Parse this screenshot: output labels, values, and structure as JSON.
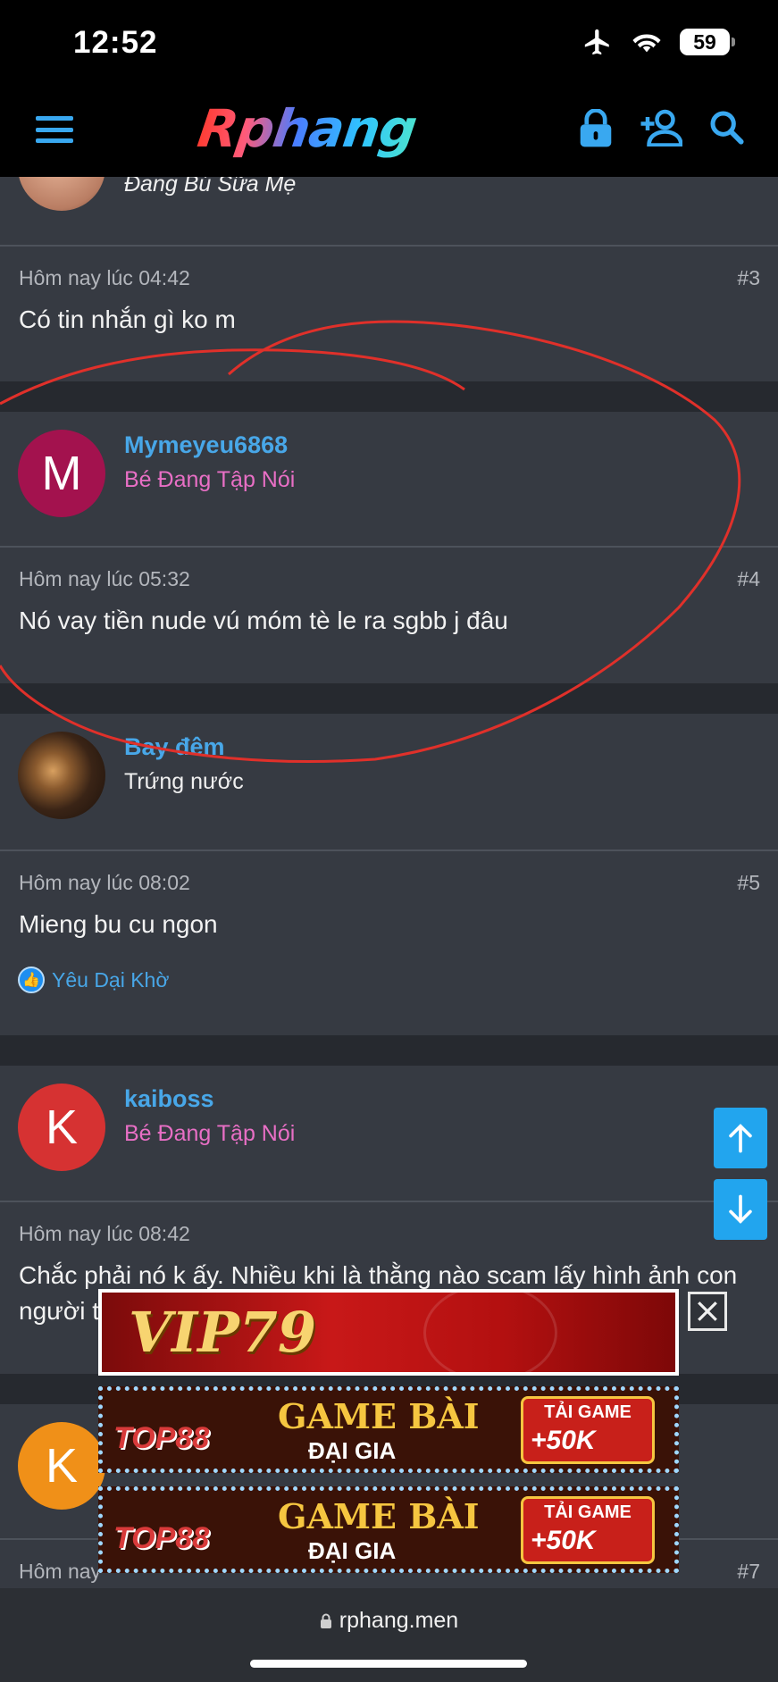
{
  "status_bar": {
    "time": "12:52",
    "battery": "59"
  },
  "nav": {
    "logo_text": "Rphang"
  },
  "posts": [
    {
      "user_title": "Đang Bú Sữa Mẹ"
    },
    {
      "timestamp": "Hôm nay lúc 04:42",
      "number": "#3",
      "message": "Có tin nhắn gì ko m"
    },
    {
      "avatar_letter": "M",
      "avatar_color": "#a3124e",
      "username": "Mymeyeu6868",
      "user_title": "Bé Đang Tập Nói",
      "user_title_color": "#e86fc5",
      "timestamp": "Hôm nay lúc 05:32",
      "number": "#4",
      "message": "Nó vay tiền nude vú móm tè le ra sgbb j đâu"
    },
    {
      "username": "Bay đêm",
      "user_title": "Trứng nước",
      "user_title_color": "#f0f0f0",
      "timestamp": "Hôm nay lúc 08:02",
      "number": "#5",
      "message": "Mieng bu cu ngon",
      "like_text": "Yêu Dại Khờ"
    },
    {
      "avatar_letter": "K",
      "avatar_color": "#d63232",
      "username": "kaiboss",
      "user_title": "Bé Đang Tập Nói",
      "user_title_color": "#e86fc5",
      "timestamp": "Hôm nay lúc 08:42",
      "message_line1": "Chắc phải nó k ấy. Nhiều khi là thằng nào scam lấy hình ảnh con",
      "message_line2": "người t"
    },
    {
      "avatar_letter": "K",
      "avatar_color": "#f09018",
      "timestamp": "Hôm nay",
      "number": "#7"
    }
  ],
  "ads": {
    "vip": {
      "brand": "VIP79"
    },
    "top88_1": {
      "brand": "TOP88",
      "headline": "GAME BÀI",
      "sub": "ĐẠI GIA",
      "cta": "TẢI GAME",
      "bonus": "+50K"
    },
    "top88_2": {
      "brand": "TOP88",
      "headline": "GAME BÀI",
      "sub": "ĐẠI GIA",
      "cta": "TẢI GAME",
      "bonus": "+50K"
    }
  },
  "address_bar": {
    "url": "rphang.men"
  },
  "colors": {
    "accent": "#48a7e8",
    "annotation": "#e0302a",
    "scroll_button": "#22a5ee"
  },
  "icons": [
    "menu-icon",
    "lock-icon",
    "add-user-icon",
    "search-icon",
    "arrow-up-icon",
    "arrow-down-icon",
    "close-icon",
    "thumbs-up-icon"
  ]
}
